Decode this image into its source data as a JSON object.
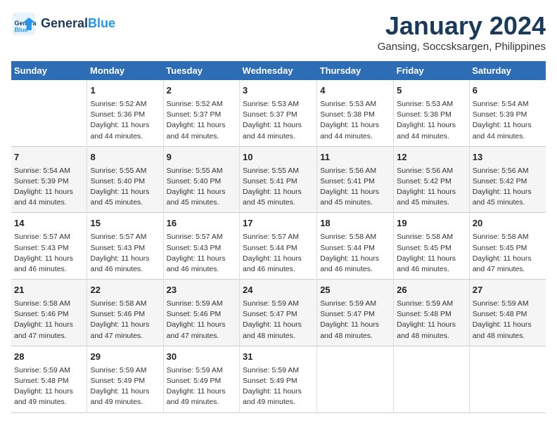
{
  "logo": {
    "text_general": "General",
    "text_blue": "Blue"
  },
  "title": "January 2024",
  "subtitle": "Gansing, Soccsksargen, Philippines",
  "headers": [
    "Sunday",
    "Monday",
    "Tuesday",
    "Wednesday",
    "Thursday",
    "Friday",
    "Saturday"
  ],
  "weeks": [
    [
      {
        "day": "",
        "info": ""
      },
      {
        "day": "1",
        "info": "Sunrise: 5:52 AM\nSunset: 5:36 PM\nDaylight: 11 hours\nand 44 minutes."
      },
      {
        "day": "2",
        "info": "Sunrise: 5:52 AM\nSunset: 5:37 PM\nDaylight: 11 hours\nand 44 minutes."
      },
      {
        "day": "3",
        "info": "Sunrise: 5:53 AM\nSunset: 5:37 PM\nDaylight: 11 hours\nand 44 minutes."
      },
      {
        "day": "4",
        "info": "Sunrise: 5:53 AM\nSunset: 5:38 PM\nDaylight: 11 hours\nand 44 minutes."
      },
      {
        "day": "5",
        "info": "Sunrise: 5:53 AM\nSunset: 5:38 PM\nDaylight: 11 hours\nand 44 minutes."
      },
      {
        "day": "6",
        "info": "Sunrise: 5:54 AM\nSunset: 5:39 PM\nDaylight: 11 hours\nand 44 minutes."
      }
    ],
    [
      {
        "day": "7",
        "info": "Sunrise: 5:54 AM\nSunset: 5:39 PM\nDaylight: 11 hours\nand 44 minutes."
      },
      {
        "day": "8",
        "info": "Sunrise: 5:55 AM\nSunset: 5:40 PM\nDaylight: 11 hours\nand 45 minutes."
      },
      {
        "day": "9",
        "info": "Sunrise: 5:55 AM\nSunset: 5:40 PM\nDaylight: 11 hours\nand 45 minutes."
      },
      {
        "day": "10",
        "info": "Sunrise: 5:55 AM\nSunset: 5:41 PM\nDaylight: 11 hours\nand 45 minutes."
      },
      {
        "day": "11",
        "info": "Sunrise: 5:56 AM\nSunset: 5:41 PM\nDaylight: 11 hours\nand 45 minutes."
      },
      {
        "day": "12",
        "info": "Sunrise: 5:56 AM\nSunset: 5:42 PM\nDaylight: 11 hours\nand 45 minutes."
      },
      {
        "day": "13",
        "info": "Sunrise: 5:56 AM\nSunset: 5:42 PM\nDaylight: 11 hours\nand 45 minutes."
      }
    ],
    [
      {
        "day": "14",
        "info": "Sunrise: 5:57 AM\nSunset: 5:43 PM\nDaylight: 11 hours\nand 46 minutes."
      },
      {
        "day": "15",
        "info": "Sunrise: 5:57 AM\nSunset: 5:43 PM\nDaylight: 11 hours\nand 46 minutes."
      },
      {
        "day": "16",
        "info": "Sunrise: 5:57 AM\nSunset: 5:43 PM\nDaylight: 11 hours\nand 46 minutes."
      },
      {
        "day": "17",
        "info": "Sunrise: 5:57 AM\nSunset: 5:44 PM\nDaylight: 11 hours\nand 46 minutes."
      },
      {
        "day": "18",
        "info": "Sunrise: 5:58 AM\nSunset: 5:44 PM\nDaylight: 11 hours\nand 46 minutes."
      },
      {
        "day": "19",
        "info": "Sunrise: 5:58 AM\nSunset: 5:45 PM\nDaylight: 11 hours\nand 46 minutes."
      },
      {
        "day": "20",
        "info": "Sunrise: 5:58 AM\nSunset: 5:45 PM\nDaylight: 11 hours\nand 47 minutes."
      }
    ],
    [
      {
        "day": "21",
        "info": "Sunrise: 5:58 AM\nSunset: 5:46 PM\nDaylight: 11 hours\nand 47 minutes."
      },
      {
        "day": "22",
        "info": "Sunrise: 5:58 AM\nSunset: 5:46 PM\nDaylight: 11 hours\nand 47 minutes."
      },
      {
        "day": "23",
        "info": "Sunrise: 5:59 AM\nSunset: 5:46 PM\nDaylight: 11 hours\nand 47 minutes."
      },
      {
        "day": "24",
        "info": "Sunrise: 5:59 AM\nSunset: 5:47 PM\nDaylight: 11 hours\nand 48 minutes."
      },
      {
        "day": "25",
        "info": "Sunrise: 5:59 AM\nSunset: 5:47 PM\nDaylight: 11 hours\nand 48 minutes."
      },
      {
        "day": "26",
        "info": "Sunrise: 5:59 AM\nSunset: 5:48 PM\nDaylight: 11 hours\nand 48 minutes."
      },
      {
        "day": "27",
        "info": "Sunrise: 5:59 AM\nSunset: 5:48 PM\nDaylight: 11 hours\nand 48 minutes."
      }
    ],
    [
      {
        "day": "28",
        "info": "Sunrise: 5:59 AM\nSunset: 5:48 PM\nDaylight: 11 hours\nand 49 minutes."
      },
      {
        "day": "29",
        "info": "Sunrise: 5:59 AM\nSunset: 5:49 PM\nDaylight: 11 hours\nand 49 minutes."
      },
      {
        "day": "30",
        "info": "Sunrise: 5:59 AM\nSunset: 5:49 PM\nDaylight: 11 hours\nand 49 minutes."
      },
      {
        "day": "31",
        "info": "Sunrise: 5:59 AM\nSunset: 5:49 PM\nDaylight: 11 hours\nand 49 minutes."
      },
      {
        "day": "",
        "info": ""
      },
      {
        "day": "",
        "info": ""
      },
      {
        "day": "",
        "info": ""
      }
    ]
  ]
}
